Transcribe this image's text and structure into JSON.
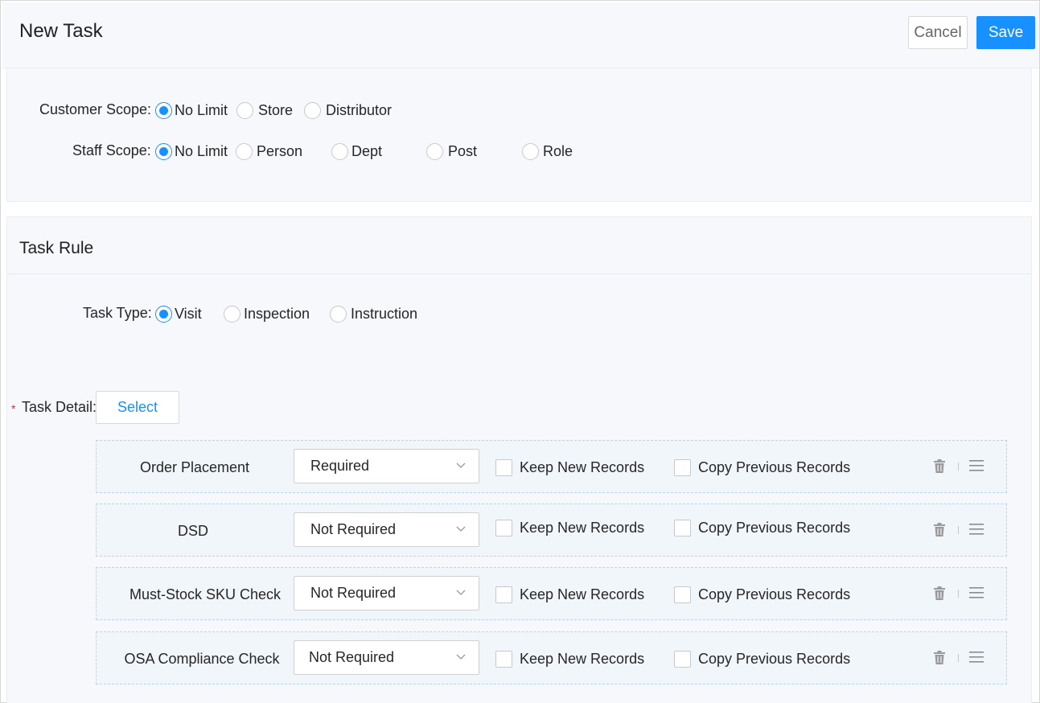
{
  "header": {
    "title": "New Task",
    "cancel_label": "Cancel",
    "save_label": "Save"
  },
  "scope": {
    "customer_label": "Customer Scope:",
    "customer_options": [
      "No Limit",
      "Store",
      "Distributor"
    ],
    "customer_selected": "No Limit",
    "staff_label": "Staff Scope:",
    "staff_options": [
      "No Limit",
      "Person",
      "Dept",
      "Post",
      "Role"
    ],
    "staff_selected": "No Limit"
  },
  "task_rule": {
    "title": "Task Rule",
    "type_label": "Task Type:",
    "type_options": [
      "Visit",
      "Inspection",
      "Instruction"
    ],
    "type_selected": "Visit",
    "detail_label": "Task Detail:",
    "required_mark": "*",
    "select_label": "Select",
    "rows": [
      {
        "name": "Order Placement",
        "requirement": "Required",
        "keep_new": "Keep New Records",
        "copy_prev": "Copy Previous Records"
      },
      {
        "name": "DSD",
        "requirement": "Not Required",
        "keep_new": "Keep New Records",
        "copy_prev": "Copy Previous Records"
      },
      {
        "name": "Must-Stock SKU Check",
        "requirement": "Not Required",
        "keep_new": "Keep New Records",
        "copy_prev": "Copy Previous Records"
      },
      {
        "name": "OSA Compliance Check",
        "requirement": "Not Required",
        "keep_new": "Keep New Records",
        "copy_prev": "Copy Previous Records"
      }
    ]
  },
  "icons": {
    "dropdown": "chevron-down-icon",
    "delete": "trash-icon",
    "drag": "drag-handle-icon"
  },
  "colors": {
    "primary": "#1890ff",
    "required": "#f5222d",
    "panel_bg": "#f7f8fc",
    "row_bg": "#f1f6fb",
    "row_border": "#b9d5e6"
  }
}
